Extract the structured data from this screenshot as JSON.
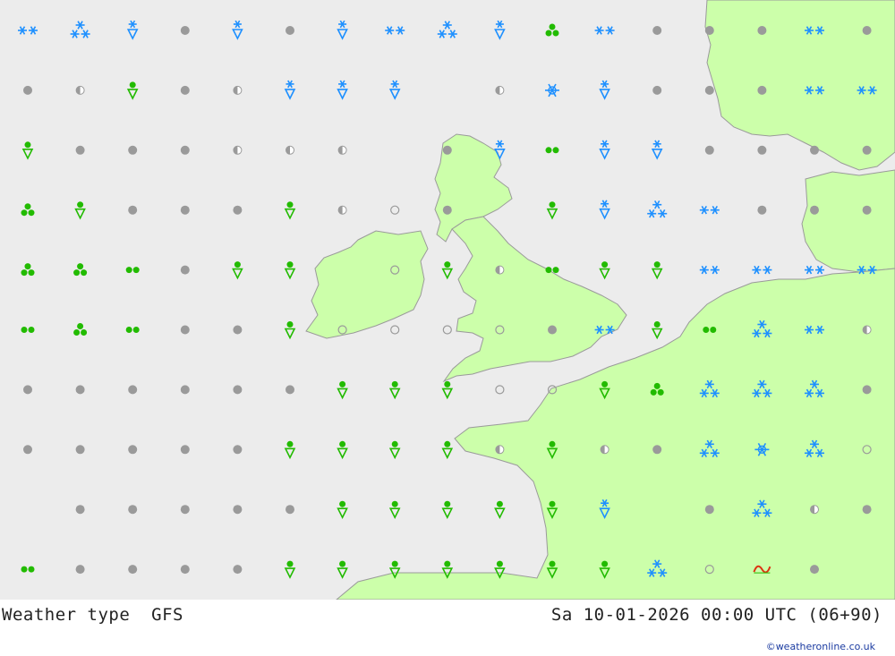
{
  "footer": {
    "product": "Weather type",
    "model": "GFS",
    "valid_time": "Sa 10-01-2026 00:00 UTC (06+90)",
    "credit": "©weatheronline.co.uk"
  },
  "colors": {
    "sea": "#ececec",
    "land": "#ccffaa",
    "coast": "#9a9a9a",
    "snow": "#1e90ff",
    "rain": "#22bb00",
    "dry": "#9a9a9a",
    "mixed": "#dd3311"
  },
  "legend_symbols": {
    "dot": "no significant weather",
    "half": "drizzle/cloud",
    "ring": "fog/haze",
    "snow1": "light snow",
    "snow2": "snow",
    "snow3": "heavy snow",
    "snowshower": "snow shower",
    "rainshower": "rain shower",
    "rain2": "rain",
    "rain3": "heavy rain",
    "bigsnow": "very heavy snow",
    "mix": "rain/snow mix"
  },
  "grid": {
    "columns": 17,
    "rows": 10,
    "symbols": [
      [
        "snow2",
        "snow3",
        "snowshower",
        "dot",
        "snowshower",
        "dot",
        "snowshower",
        "snow2",
        "snow3",
        "snowshower",
        "rain3",
        "snow2",
        "dot",
        "dot",
        "dot",
        "snow2",
        "dot"
      ],
      [
        "dot",
        "half",
        "rainshower",
        "dot",
        "half",
        "snowshower",
        "snowshower",
        "snowshower",
        "",
        "half",
        "bigsnow",
        "snowshower",
        "dot",
        "dot",
        "dot",
        "snow2",
        "snow2"
      ],
      [
        "rainshower",
        "dot",
        "dot",
        "dot",
        "half",
        "half",
        "half",
        "",
        "dot",
        "snowshower",
        "rain2",
        "snowshower",
        "snowshower",
        "dot",
        "dot",
        "dot",
        "dot"
      ],
      [
        "rain3",
        "rainshower",
        "dot",
        "dot",
        "dot",
        "rainshower",
        "half",
        "ring",
        "dot",
        "",
        "rainshower",
        "snowshower",
        "snow3",
        "snow2",
        "dot",
        "dot",
        "dot"
      ],
      [
        "rain3",
        "rain3",
        "rain2",
        "dot",
        "rainshower",
        "rainshower",
        "",
        "ring",
        "rainshower",
        "half",
        "rain2",
        "rainshower",
        "rainshower",
        "snow2",
        "snow2",
        "snow2",
        "snow2"
      ],
      [
        "rain2",
        "rain3",
        "rain2",
        "dot",
        "dot",
        "rainshower",
        "ring",
        "ring",
        "ring",
        "ring",
        "dot",
        "snow2",
        "rainshower",
        "rain2",
        "snow3",
        "snow2",
        "half"
      ],
      [
        "dot",
        "dot",
        "dot",
        "dot",
        "dot",
        "dot",
        "rainshower",
        "rainshower",
        "rainshower",
        "ring",
        "ring",
        "rainshower",
        "rain3",
        "snow3",
        "snow3",
        "snow3",
        "dot"
      ],
      [
        "dot",
        "dot",
        "dot",
        "dot",
        "dot",
        "rainshower",
        "rainshower",
        "rainshower",
        "rainshower",
        "half",
        "rainshower",
        "half",
        "dot",
        "snow3",
        "bigsnow",
        "snow3",
        "ring"
      ],
      [
        "",
        "dot",
        "dot",
        "dot",
        "dot",
        "dot",
        "rainshower",
        "rainshower",
        "rainshower",
        "rainshower",
        "rainshower",
        "snowshower",
        "",
        "dot",
        "snow3",
        "half",
        "dot"
      ],
      [
        "rain2",
        "dot",
        "dot",
        "dot",
        "dot",
        "rainshower",
        "rainshower",
        "rainshower",
        "rainshower",
        "rainshower",
        "rainshower",
        "rainshower",
        "snow3",
        "ring",
        "mix",
        "dot",
        ""
      ]
    ]
  }
}
